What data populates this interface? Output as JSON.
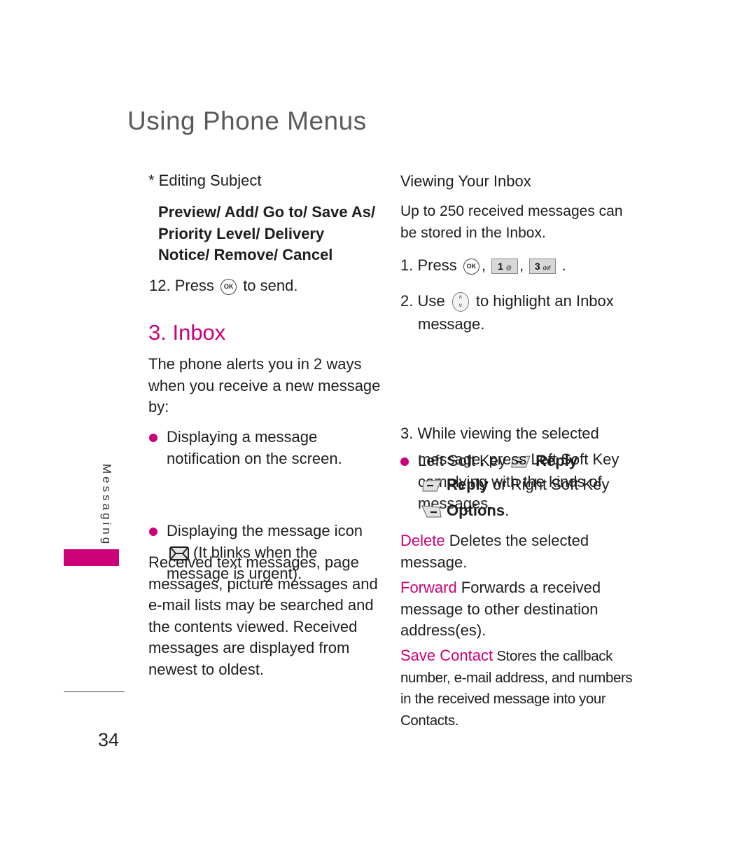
{
  "header": {
    "title": "Using Phone Menus"
  },
  "sidebar": {
    "section_label": "Messaging",
    "accent_color": "#cc0077"
  },
  "footer": {
    "page_number": "34"
  },
  "left_column": {
    "editing_subject": "* Editing Subject",
    "options_line1": "Preview/ Add/ Go to/ Save As/",
    "options_line2": "Priority Level/ Delivery",
    "options_line3": "Notice/ Remove/ Cancel",
    "step12_prefix": "12.  Press",
    "step12_suffix": "to send.",
    "section_title": "3. Inbox",
    "intro": [
      "The phone alerts you in 2 ways",
      "when you receive a new message",
      "by:"
    ],
    "bullets": [
      {
        "lines": [
          "Displaying a message",
          "notification on the screen."
        ]
      },
      {
        "line1": "Displaying the message icon",
        "line2": "(It blinks when the",
        "line3": "message is urgent)."
      }
    ],
    "paragraph": [
      "Received text messages, page",
      "messages, picture messages and",
      "e-mail lists may be searched and",
      "the contents viewed. Received",
      "messages are displayed from",
      "newest to oldest."
    ]
  },
  "right_column": {
    "subheading": "Viewing Your Inbox",
    "intro": [
      "Up to 250 received messages can",
      "be stored in the Inbox."
    ],
    "step1": {
      "prefix": "1. Press",
      "keys": [
        "OK",
        "1",
        "3"
      ],
      "key1_sub": "@",
      "key3_sub": "def",
      "sep": ",",
      "end": "."
    },
    "step2": {
      "prefix": "2. Use",
      "suffix": "to highlight an Inbox",
      "line2": "message."
    },
    "bullet": {
      "prefix": "Left Soft Key",
      "bold": "Reply",
      "line2": "complying with the kinds of",
      "line3": "messages."
    },
    "step3": {
      "line1": "3. While viewing the selected",
      "line2": "message, press Left Soft Key",
      "reply": "Reply",
      "middle": " or Right Soft Key",
      "options": "Options",
      "end": "."
    },
    "options": [
      {
        "term": "Delete",
        "desc_line1": " Deletes the selected",
        "desc_line2": "message."
      },
      {
        "term": "Forward",
        "desc_line1": " Forwards a received",
        "desc_line2": "message to other destination",
        "desc_line3": "address(es)."
      },
      {
        "term": "Save Contact",
        "desc_line1": " Stores the callback",
        "desc_line2": "number, e-mail address, and numbers",
        "desc_line3": "in  the received message into your",
        "desc_line4": "Contacts."
      }
    ]
  },
  "keys": {
    "ok_label": "OK"
  }
}
